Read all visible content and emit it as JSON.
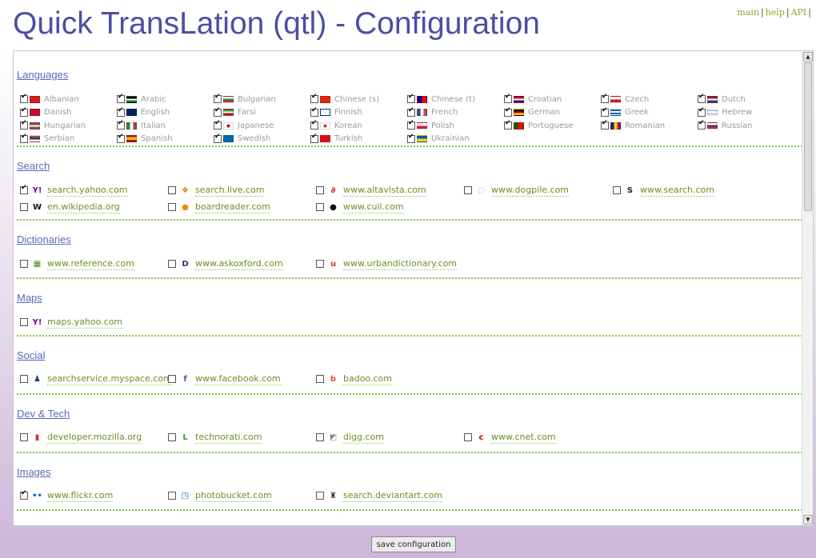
{
  "header": {
    "title": "Quick TransLation (qtl) - Configuration",
    "links": [
      "main",
      "help",
      "API"
    ]
  },
  "sections": {
    "languages": {
      "title": "Languages",
      "items": [
        {
          "label": "Albanian",
          "checked": true,
          "icon": "albania-flag-icon"
        },
        {
          "label": "Arabic",
          "checked": true,
          "icon": "arabic-flag-icon"
        },
        {
          "label": "Bulgarian",
          "checked": true,
          "icon": "bulgaria-flag-icon"
        },
        {
          "label": "Chinese (s)",
          "checked": true,
          "icon": "china-flag-icon"
        },
        {
          "label": "Chinese (t)",
          "checked": true,
          "icon": "taiwan-flag-icon"
        },
        {
          "label": "Croatian",
          "checked": true,
          "icon": "croatia-flag-icon"
        },
        {
          "label": "Czech",
          "checked": true,
          "icon": "czech-flag-icon"
        },
        {
          "label": "Dutch",
          "checked": true,
          "icon": "netherlands-flag-icon"
        },
        {
          "label": "Danish",
          "checked": true,
          "icon": "denmark-flag-icon"
        },
        {
          "label": "English",
          "checked": true,
          "icon": "uk-flag-icon"
        },
        {
          "label": "Farsi",
          "checked": true,
          "icon": "iran-flag-icon"
        },
        {
          "label": "Finnish",
          "checked": true,
          "icon": "finland-flag-icon"
        },
        {
          "label": "French",
          "checked": true,
          "icon": "france-flag-icon"
        },
        {
          "label": "German",
          "checked": true,
          "icon": "germany-flag-icon"
        },
        {
          "label": "Greek",
          "checked": true,
          "icon": "greece-flag-icon"
        },
        {
          "label": "Hebrew",
          "checked": true,
          "icon": "israel-flag-icon"
        },
        {
          "label": "Hungarian",
          "checked": true,
          "icon": "hungary-flag-icon"
        },
        {
          "label": "Italian",
          "checked": true,
          "icon": "italy-flag-icon"
        },
        {
          "label": "Japanese",
          "checked": true,
          "icon": "japan-flag-icon"
        },
        {
          "label": "Korean",
          "checked": true,
          "icon": "korea-flag-icon"
        },
        {
          "label": "Polish",
          "checked": true,
          "icon": "poland-flag-icon"
        },
        {
          "label": "Portuguese",
          "checked": true,
          "icon": "portugal-flag-icon"
        },
        {
          "label": "Romanian",
          "checked": true,
          "icon": "romania-flag-icon"
        },
        {
          "label": "Russian",
          "checked": true,
          "icon": "russia-flag-icon"
        },
        {
          "label": "Serbian",
          "checked": true,
          "icon": "serbia-flag-icon"
        },
        {
          "label": "Spanish",
          "checked": true,
          "icon": "spain-flag-icon"
        },
        {
          "label": "Swedish",
          "checked": true,
          "icon": "sweden-flag-icon"
        },
        {
          "label": "Turkish",
          "checked": true,
          "icon": "turkey-flag-icon"
        },
        {
          "label": "Ukrainian",
          "checked": true,
          "icon": "ukraine-flag-icon"
        }
      ]
    },
    "search": {
      "title": "Search",
      "items": [
        {
          "label": "search.yahoo.com",
          "checked": true,
          "icon": "yahoo-icon"
        },
        {
          "label": "search.live.com",
          "checked": false,
          "icon": "windows-live-icon"
        },
        {
          "label": "www.altavista.com",
          "checked": false,
          "icon": "altavista-icon"
        },
        {
          "label": "www.dogpile.com",
          "checked": false,
          "icon": "dogpile-icon"
        },
        {
          "label": "www.search.com",
          "checked": false,
          "icon": "search-com-icon"
        },
        {
          "label": "en.wikipedia.org",
          "checked": false,
          "icon": "wikipedia-icon"
        },
        {
          "label": "boardreader.com",
          "checked": false,
          "icon": "boardreader-icon"
        },
        {
          "label": "www.cuil.com",
          "checked": false,
          "icon": "cuil-icon"
        }
      ]
    },
    "dictionaries": {
      "title": "Dictionaries",
      "items": [
        {
          "label": "www.reference.com",
          "checked": false,
          "icon": "reference-icon"
        },
        {
          "label": "www.askoxford.com",
          "checked": false,
          "icon": "askoxford-icon"
        },
        {
          "label": "www.urbandictionary.com",
          "checked": false,
          "icon": "urbandictionary-icon"
        }
      ]
    },
    "maps": {
      "title": "Maps",
      "items": [
        {
          "label": "maps.yahoo.com",
          "checked": false,
          "icon": "yahoo-icon"
        }
      ]
    },
    "social": {
      "title": "Social",
      "items": [
        {
          "label": "searchservice.myspace.com",
          "checked": false,
          "icon": "myspace-icon"
        },
        {
          "label": "www.facebook.com",
          "checked": false,
          "icon": "facebook-icon"
        },
        {
          "label": "badoo.com",
          "checked": false,
          "icon": "badoo-icon"
        }
      ]
    },
    "devtech": {
      "title": "Dev & Tech",
      "items": [
        {
          "label": "developer.mozilla.org",
          "checked": false,
          "icon": "mozilla-icon"
        },
        {
          "label": "technorati.com",
          "checked": false,
          "icon": "technorati-icon"
        },
        {
          "label": "digg.com",
          "checked": false,
          "icon": "digg-icon"
        },
        {
          "label": "www.cnet.com",
          "checked": false,
          "icon": "cnet-icon"
        }
      ]
    },
    "images": {
      "title": "Images",
      "items": [
        {
          "label": "www.flickr.com",
          "checked": true,
          "icon": "flickr-icon"
        },
        {
          "label": "photobucket.com",
          "checked": false,
          "icon": "photobucket-icon"
        },
        {
          "label": "search.deviantart.com",
          "checked": false,
          "icon": "deviantart-icon"
        }
      ]
    }
  },
  "footer": {
    "save_label": "save configuration"
  }
}
